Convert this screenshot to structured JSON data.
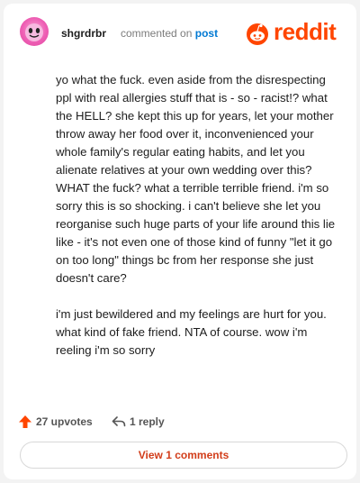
{
  "comment": {
    "username": "shgrdrbr",
    "action_text": "commented on",
    "target_link": "post",
    "paragraphs": [
      "yo what the fuck. even aside from the disrespecting ppl with real allergies stuff that is - so - racist!? what the HELL? she kept this up for years, let your mother throw away her food over it, inconvenienced your whole family's regular eating habits, and let you alienate relatives at your own wedding over this? WHAT the fuck? what a terrible terrible friend. i'm so sorry this is so shocking. i can't believe she let you reorganise such huge parts of your life around this lie like - it's not even one of those kind of funny \"let it go on too long\" things bc from her response she just doesn't care?",
      "i'm just bewildered and my feelings are hurt for you. what kind of fake friend. NTA of course. wow i'm reeling i'm so sorry"
    ],
    "upvotes_label": "27 upvotes",
    "reply_label": "1 reply",
    "view_comments_label": "View 1 comments"
  },
  "brand": {
    "wordmark": "reddit",
    "color": "#ff4500"
  },
  "icons": {
    "avatar": "avatar",
    "upvote": "upvote-arrow-icon",
    "reply": "reply-icon",
    "logo": "reddit-snoo-icon"
  }
}
